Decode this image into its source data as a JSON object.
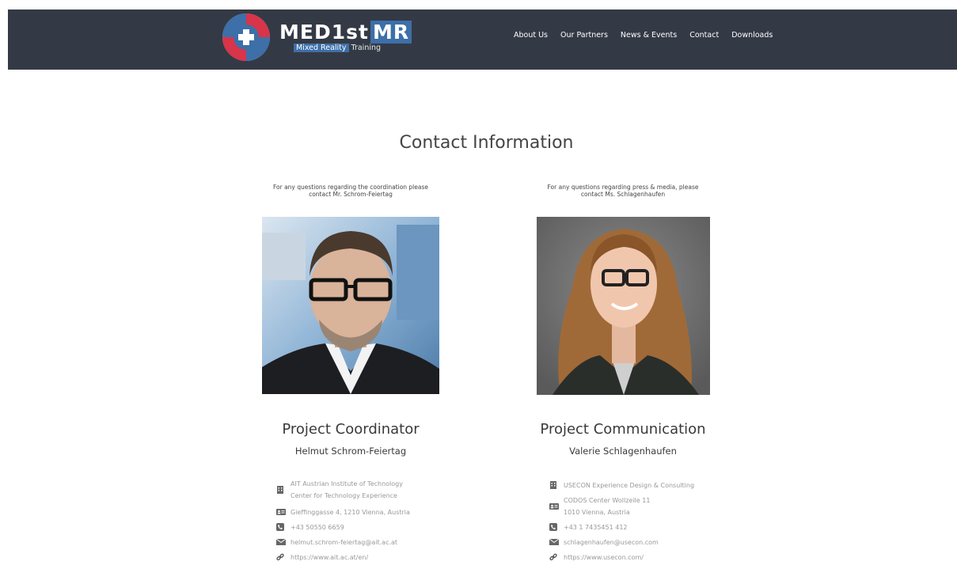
{
  "header": {
    "logo_title": "MED1st",
    "logo_title_mr": "MR",
    "logo_sub_highlight": "Mixed Reality",
    "logo_sub_rest": " Training",
    "nav": [
      "About Us",
      "Our Partners",
      "News & Events",
      "Contact",
      "Downloads"
    ]
  },
  "main": {
    "title": "Contact Information",
    "contacts": [
      {
        "intro_line1": "For any questions regarding the coordination please",
        "intro_line2": "contact Mr. Schrom-Feiertag",
        "role": "Project Coordinator",
        "name": "Helmut Schrom-Feiertag",
        "org_line1": "AIT Austrian Institute of Technology",
        "org_line2": "Center for Technology Experience",
        "address_line1": "Gieffinggasse 4, 1210 Vienna, Austria",
        "phone": "+43 50550 6659",
        "email": "helmut.schrom-feiertag@ait.ac.at",
        "web": "https://www.ait.ac.at/en/"
      },
      {
        "intro_line1": "For any questions regarding press & media, please",
        "intro_line2": "contact Ms. Schlagenhaufen",
        "role": "Project Communication",
        "name": "Valerie Schlagenhaufen",
        "org_line1": "USECON Experience Design & Consulting",
        "address_line1": "CODOS Center Wollzeile 11",
        "address_line2": "1010 Vienna, Austria",
        "phone": "+43 1 7435451 412",
        "email": "schlagenhaufen@usecon.com",
        "web": "https://www.usecon.com/"
      }
    ]
  },
  "colors": {
    "header_bg": "#343a45",
    "brand_blue": "#3d6fa8",
    "brand_red": "#d8344a",
    "info_text": "#999999"
  },
  "icons": [
    "building-icon",
    "address-card-icon",
    "phone-icon",
    "envelope-icon",
    "link-icon"
  ]
}
